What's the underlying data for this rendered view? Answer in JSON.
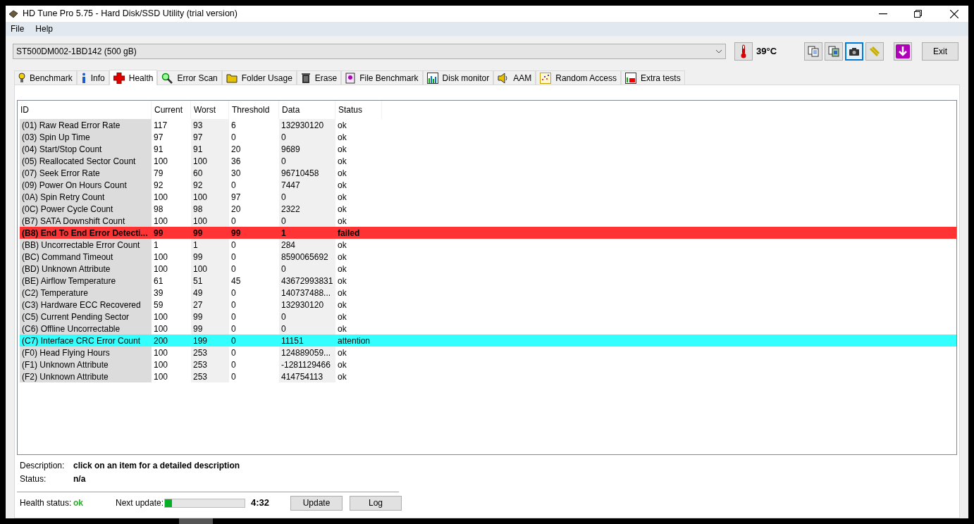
{
  "window": {
    "title": "HD Tune Pro 5.75 - Hard Disk/SSD Utility (trial version)"
  },
  "menu": [
    {
      "label": "File"
    },
    {
      "label": "Help"
    }
  ],
  "drive_select": {
    "value": "ST500DM002-1BD142 (500 gB)"
  },
  "temperature": "39°C",
  "toolbar_buttons": [
    {
      "kind": "copy",
      "selected": false
    },
    {
      "kind": "copy-image",
      "selected": false
    },
    {
      "kind": "camera",
      "selected": true
    },
    {
      "kind": "options",
      "selected": false
    },
    {
      "kind": "download",
      "selected": false
    }
  ],
  "exit_button": "Exit",
  "tabs": [
    {
      "label": "Benchmark",
      "kind": "bulb",
      "selected": false
    },
    {
      "label": "Info",
      "kind": "info",
      "selected": false
    },
    {
      "label": "Health",
      "kind": "cross",
      "selected": true
    },
    {
      "label": "Error Scan",
      "kind": "magnifier",
      "selected": false
    },
    {
      "label": "Folder Usage",
      "kind": "folder",
      "selected": false
    },
    {
      "label": "Erase",
      "kind": "trash",
      "selected": false
    },
    {
      "label": "File Benchmark",
      "kind": "file",
      "selected": false
    },
    {
      "label": "Disk monitor",
      "kind": "chart",
      "selected": false
    },
    {
      "label": "AAM",
      "kind": "speaker",
      "selected": false
    },
    {
      "label": "Random Access",
      "kind": "dots",
      "selected": false
    },
    {
      "label": "Extra tests",
      "kind": "grid",
      "selected": false
    }
  ],
  "table": {
    "columns": [
      "ID",
      "Current",
      "Worst",
      "Threshold",
      "Data",
      "Status"
    ],
    "rows": [
      {
        "kind": "ok",
        "cells": [
          "(01) Raw Read Error Rate",
          "117",
          "93",
          "6",
          "132930120",
          "ok"
        ]
      },
      {
        "kind": "ok",
        "cells": [
          "(03) Spin Up Time",
          "97",
          "97",
          "0",
          "0",
          "ok"
        ]
      },
      {
        "kind": "ok",
        "cells": [
          "(04) Start/Stop Count",
          "91",
          "91",
          "20",
          "9689",
          "ok"
        ]
      },
      {
        "kind": "ok",
        "cells": [
          "(05) Reallocated Sector Count",
          "100",
          "100",
          "36",
          "0",
          "ok"
        ]
      },
      {
        "kind": "ok",
        "cells": [
          "(07) Seek Error Rate",
          "79",
          "60",
          "30",
          "96710458",
          "ok"
        ]
      },
      {
        "kind": "ok",
        "cells": [
          "(09) Power On Hours Count",
          "92",
          "92",
          "0",
          "7447",
          "ok"
        ]
      },
      {
        "kind": "ok",
        "cells": [
          "(0A) Spin Retry Count",
          "100",
          "100",
          "97",
          "0",
          "ok"
        ]
      },
      {
        "kind": "ok",
        "cells": [
          "(0C) Power Cycle Count",
          "98",
          "98",
          "20",
          "2322",
          "ok"
        ]
      },
      {
        "kind": "ok",
        "cells": [
          "(B7) SATA Downshift Count",
          "100",
          "100",
          "0",
          "0",
          "ok"
        ]
      },
      {
        "kind": "failed",
        "cells": [
          "(B8) End To End Error Detecti...",
          "99",
          "99",
          "99",
          "1",
          "failed"
        ]
      },
      {
        "kind": "ok",
        "cells": [
          "(BB) Uncorrectable Error Count",
          "1",
          "1",
          "0",
          "284",
          "ok"
        ]
      },
      {
        "kind": "ok",
        "cells": [
          "(BC) Command Timeout",
          "100",
          "99",
          "0",
          "8590065692",
          "ok"
        ]
      },
      {
        "kind": "ok",
        "cells": [
          "(BD) Unknown Attribute",
          "100",
          "100",
          "0",
          "0",
          "ok"
        ]
      },
      {
        "kind": "ok",
        "cells": [
          "(BE) Airflow Temperature",
          "61",
          "51",
          "45",
          "43672993831",
          "ok"
        ]
      },
      {
        "kind": "ok",
        "cells": [
          "(C2) Temperature",
          "39",
          "49",
          "0",
          "140737488...",
          "ok"
        ]
      },
      {
        "kind": "ok",
        "cells": [
          "(C3) Hardware ECC Recovered",
          "59",
          "27",
          "0",
          "132930120",
          "ok"
        ]
      },
      {
        "kind": "ok",
        "cells": [
          "(C5) Current Pending Sector",
          "100",
          "99",
          "0",
          "0",
          "ok"
        ]
      },
      {
        "kind": "ok",
        "cells": [
          "(C6) Offline Uncorrectable",
          "100",
          "99",
          "0",
          "0",
          "ok"
        ]
      },
      {
        "kind": "attention",
        "cells": [
          "(C7) Interface CRC Error Count",
          "200",
          "199",
          "0",
          "11151",
          "attention"
        ]
      },
      {
        "kind": "ok",
        "cells": [
          "(F0) Head Flying Hours",
          "100",
          "253",
          "0",
          "124889059...",
          "ok"
        ]
      },
      {
        "kind": "ok",
        "cells": [
          "(F1) Unknown Attribute",
          "100",
          "253",
          "0",
          "-1281129466",
          "ok"
        ]
      },
      {
        "kind": "ok",
        "cells": [
          "(F2) Unknown Attribute",
          "100",
          "253",
          "0",
          "414754113",
          "ok"
        ]
      }
    ]
  },
  "description": {
    "label": "Description:",
    "value": "click on an item for a detailed description"
  },
  "status": {
    "label": "Status:",
    "value": "n/a"
  },
  "health_status": {
    "label": "Health status:",
    "value": "ok"
  },
  "next_update": {
    "label": "Next update:",
    "level": 0.09,
    "time": "4:32"
  },
  "buttons": [
    "Update",
    "Log"
  ]
}
